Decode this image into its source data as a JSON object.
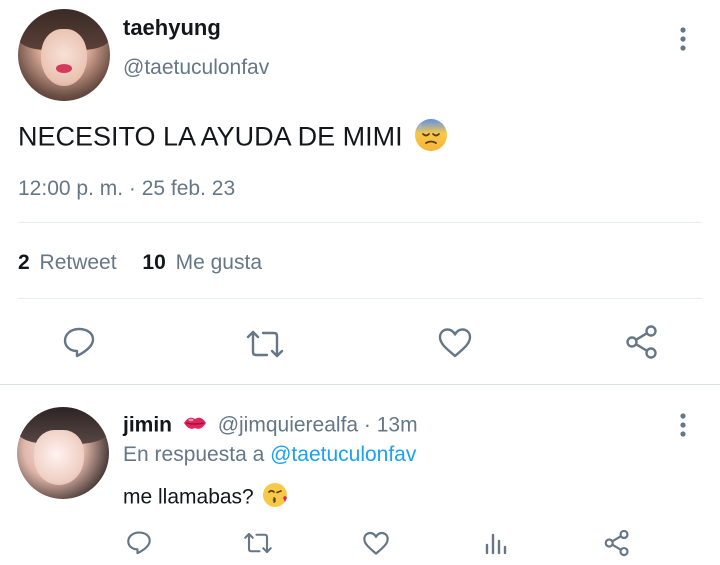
{
  "tweet": {
    "display_name": "taehyung",
    "handle": "@taetuculonfav",
    "text": "NECESITO LA AYUDA DE MIMI",
    "emoji_icon": "sweat-sad-emoji-icon",
    "timestamp": "12:00 p. m. · 25 feb. 23",
    "retweets_count": "2",
    "retweets_label": "Retweet",
    "likes_count": "10",
    "likes_label": "Me gusta"
  },
  "reply": {
    "display_name": "jimin",
    "name_emoji_icon": "kiss-lips-emoji-icon",
    "handle_time": "@jimquierealfa · 13m",
    "in_reply_prefix": "En respuesta a",
    "in_reply_handle": "@taetuculonfav",
    "text": "me llamabas?",
    "emoji_icon": "kissing-face-emoji-icon"
  },
  "colors": {
    "text": "#14171a",
    "muted": "#657786",
    "link": "#1da1f2",
    "divider": "#e6ecf0"
  }
}
